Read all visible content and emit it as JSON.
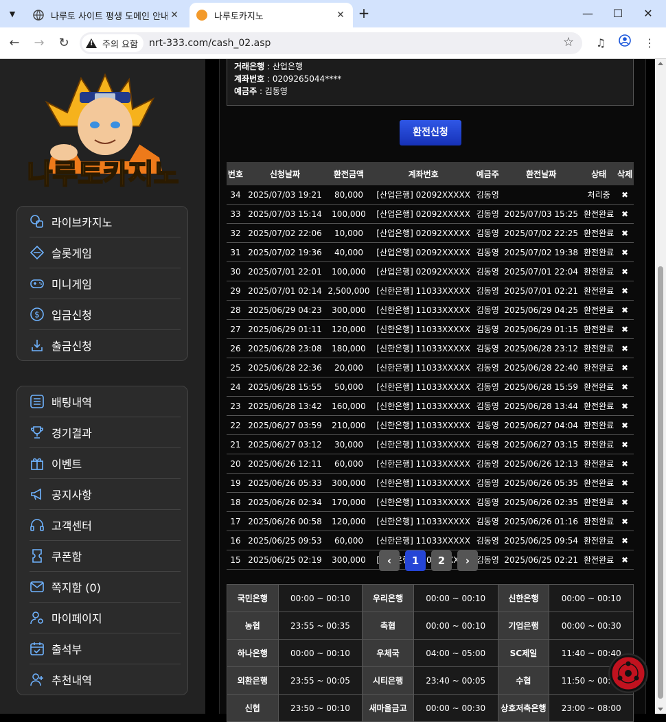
{
  "browser": {
    "tabs": [
      {
        "title": "나루토 사이트 평생 도메인 안내",
        "active": false
      },
      {
        "title": "나루토카지노",
        "active": true
      }
    ],
    "security_label": "주의 요함",
    "url": "nrt-333.com/cash_02.asp"
  },
  "brand": {
    "logo_text": "나루토카지노"
  },
  "sidebar": {
    "group1": [
      {
        "label": "라이브카지노",
        "icon": "casino-chip-icon"
      },
      {
        "label": "슬롯게임",
        "icon": "diamond-icon"
      },
      {
        "label": "미니게임",
        "icon": "gamepad-icon"
      },
      {
        "label": "입금신청",
        "icon": "dollar-coin-icon"
      },
      {
        "label": "출금신청",
        "icon": "download-icon"
      }
    ],
    "group2": [
      {
        "label": "배팅내역",
        "icon": "list-icon"
      },
      {
        "label": "경기결과",
        "icon": "trophy-icon"
      },
      {
        "label": "이벤트",
        "icon": "gift-icon"
      },
      {
        "label": "공지사항",
        "icon": "megaphone-icon"
      },
      {
        "label": "고객센터",
        "icon": "headset-icon"
      },
      {
        "label": "쿠폰함",
        "icon": "coupon-icon"
      },
      {
        "label": "쪽지함 (0)",
        "icon": "mail-icon"
      },
      {
        "label": "마이페이지",
        "icon": "user-gear-icon"
      },
      {
        "label": "출석부",
        "icon": "calendar-icon"
      },
      {
        "label": "추천내역",
        "icon": "user-plus-icon"
      }
    ]
  },
  "account": {
    "bank_label": "거래은행",
    "bank_value": "산업은행",
    "number_label": "계좌번호",
    "number_value": "0209265044****",
    "holder_label": "예금주",
    "holder_value": "김동영"
  },
  "submit_label": "환전신청",
  "history": {
    "headers": [
      "번호",
      "신청날짜",
      "환전금액",
      "계좌번호",
      "예금주",
      "환전날짜",
      "상태",
      "삭제"
    ],
    "delete_glyph": "✖",
    "rows": [
      [
        "34",
        "2025/07/03 19:21",
        "80,000",
        "[산업은행] 02092XXXXX",
        "김동영",
        "",
        "처리중"
      ],
      [
        "33",
        "2025/07/03 15:14",
        "100,000",
        "[산업은행] 02092XXXXX",
        "김동영",
        "2025/07/03 15:25",
        "환전완료"
      ],
      [
        "32",
        "2025/07/02 22:06",
        "10,000",
        "[산업은행] 02092XXXXX",
        "김동영",
        "2025/07/02 22:25",
        "환전완료"
      ],
      [
        "31",
        "2025/07/02 19:36",
        "40,000",
        "[산업은행] 02092XXXXX",
        "김동영",
        "2025/07/02 19:38",
        "환전완료"
      ],
      [
        "30",
        "2025/07/01 22:01",
        "100,000",
        "[산업은행] 02092XXXXX",
        "김동영",
        "2025/07/01 22:04",
        "환전완료"
      ],
      [
        "29",
        "2025/07/01 02:14",
        "2,500,000",
        "[신한은행] 11033XXXXX",
        "김동영",
        "2025/07/01 02:21",
        "환전완료"
      ],
      [
        "28",
        "2025/06/29 04:23",
        "300,000",
        "[신한은행] 11033XXXXX",
        "김동영",
        "2025/06/29 04:25",
        "환전완료"
      ],
      [
        "27",
        "2025/06/29 01:11",
        "120,000",
        "[신한은행] 11033XXXXX",
        "김동영",
        "2025/06/29 01:15",
        "환전완료"
      ],
      [
        "26",
        "2025/06/28 23:08",
        "180,000",
        "[신한은행] 11033XXXXX",
        "김동영",
        "2025/06/28 23:12",
        "환전완료"
      ],
      [
        "25",
        "2025/06/28 22:36",
        "20,000",
        "[신한은행] 11033XXXXX",
        "김동영",
        "2025/06/28 22:40",
        "환전완료"
      ],
      [
        "24",
        "2025/06/28 15:55",
        "50,000",
        "[신한은행] 11033XXXXX",
        "김동영",
        "2025/06/28 15:59",
        "환전완료"
      ],
      [
        "23",
        "2025/06/28 13:42",
        "160,000",
        "[신한은행] 11033XXXXX",
        "김동영",
        "2025/06/28 13:44",
        "환전완료"
      ],
      [
        "22",
        "2025/06/27 03:59",
        "210,000",
        "[신한은행] 11033XXXXX",
        "김동영",
        "2025/06/27 04:04",
        "환전완료"
      ],
      [
        "21",
        "2025/06/27 03:12",
        "30,000",
        "[신한은행] 11033XXXXX",
        "김동영",
        "2025/06/27 03:15",
        "환전완료"
      ],
      [
        "20",
        "2025/06/26 12:11",
        "60,000",
        "[신한은행] 11033XXXXX",
        "김동영",
        "2025/06/26 12:13",
        "환전완료"
      ],
      [
        "19",
        "2025/06/26 05:33",
        "300,000",
        "[신한은행] 11033XXXXX",
        "김동영",
        "2025/06/26 05:35",
        "환전완료"
      ],
      [
        "18",
        "2025/06/26 02:34",
        "170,000",
        "[신한은행] 11033XXXXX",
        "김동영",
        "2025/06/26 02:35",
        "환전완료"
      ],
      [
        "17",
        "2025/06/26 00:58",
        "120,000",
        "[신한은행] 11033XXXXX",
        "김동영",
        "2025/06/26 01:16",
        "환전완료"
      ],
      [
        "16",
        "2025/06/25 09:53",
        "60,000",
        "[신한은행] 11033XXXXX",
        "김동영",
        "2025/06/25 09:54",
        "환전완료"
      ],
      [
        "15",
        "2025/06/25 02:19",
        "300,000",
        "[신한은행] 11033XXXXX",
        "김동영",
        "2025/06/25 02:21",
        "환전완료"
      ]
    ]
  },
  "pagination": {
    "prev": "‹",
    "pages": [
      "1",
      "2"
    ],
    "current": "1",
    "next": "›"
  },
  "bank_hours": [
    [
      [
        "국민은행",
        "00:00 ~ 00:10"
      ],
      [
        "우리은행",
        "00:00 ~ 00:10"
      ],
      [
        "신한은행",
        "00:00 ~ 00:10"
      ]
    ],
    [
      [
        "농협",
        "23:55 ~ 00:35"
      ],
      [
        "축협",
        "00:00 ~ 00:10"
      ],
      [
        "기업은행",
        "00:00 ~ 00:30"
      ]
    ],
    [
      [
        "하나은행",
        "00:00 ~ 00:10"
      ],
      [
        "우체국",
        "04:00 ~ 05:00"
      ],
      [
        "SC제일",
        "11:40 ~ 00:40"
      ]
    ],
    [
      [
        "외환은행",
        "23:55 ~ 00:05"
      ],
      [
        "시티은행",
        "23:40 ~ 00:05"
      ],
      [
        "수협",
        "11:50 ~ 00:00"
      ]
    ],
    [
      [
        "신협",
        "23:50 ~ 00:10"
      ],
      [
        "새마을금고",
        "00:00 ~ 00:30"
      ],
      [
        "상호저축은행",
        "23:00 ~ 08:00"
      ]
    ]
  ],
  "colors": {
    "accent": "#2545d6",
    "link_icon": "#6fb3ff",
    "sidebar_bg": "#222222"
  }
}
